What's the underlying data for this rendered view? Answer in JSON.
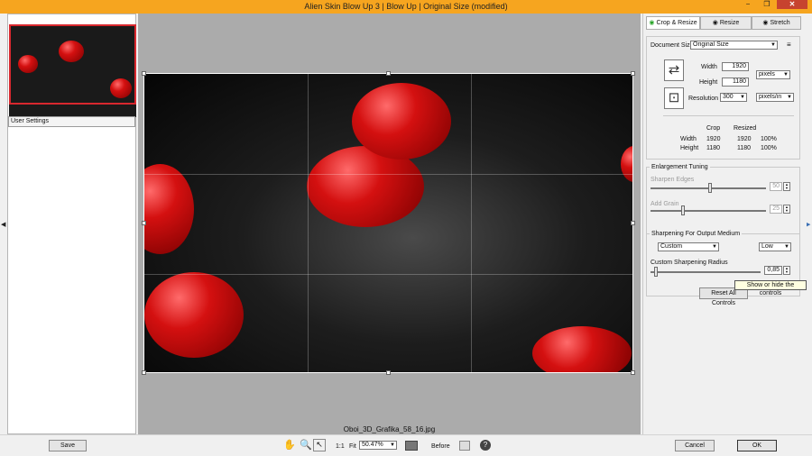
{
  "window": {
    "title": "Alien Skin Blow Up 3 | Blow Up | Original Size (modified)",
    "minimize": "−",
    "maximize": "❐",
    "close": "✕"
  },
  "left_panel": {
    "user_settings": "User Settings"
  },
  "canvas": {
    "filename": "Oboi_3D_Grafika_58_16.jpg"
  },
  "tabs": [
    {
      "label": "Crop & Resize",
      "active": true
    },
    {
      "label": "Resize",
      "active": false
    },
    {
      "label": "Stretch",
      "active": false
    }
  ],
  "document": {
    "size_label": "Document Size",
    "size_value": "Original Size",
    "width_label": "Width",
    "width_value": "1920",
    "height_label": "Height",
    "height_value": "1180",
    "unit": "pixels",
    "resolution_label": "Resolution",
    "resolution_value": "300",
    "resolution_unit": "pixels/in"
  },
  "size_table": {
    "headers": [
      "Crop",
      "Resized"
    ],
    "rows": [
      {
        "label": "Width",
        "crop": "1920",
        "resized": "1920",
        "percent": "100%"
      },
      {
        "label": "Height",
        "crop": "1180",
        "resized": "1180",
        "percent": "100%"
      }
    ]
  },
  "enlargement": {
    "title": "Enlargement Tuning",
    "sharpen_label": "Sharpen Edges",
    "sharpen_value": "50",
    "grain_label": "Add Grain",
    "grain_value": "25"
  },
  "sharpening": {
    "title": "Sharpening For Output Medium",
    "medium": "Custom",
    "amount": "Low",
    "radius_label": "Custom Sharpening Radius",
    "radius_value": "0,85"
  },
  "tooltip": "Show or hide the controls",
  "reset_button": "Reset All Controls",
  "bottom": {
    "save": "Save",
    "one_to_one": "1:1",
    "fit": "Fit",
    "zoom": "50.47%",
    "before": "Before",
    "cancel": "Cancel",
    "ok": "OK"
  }
}
